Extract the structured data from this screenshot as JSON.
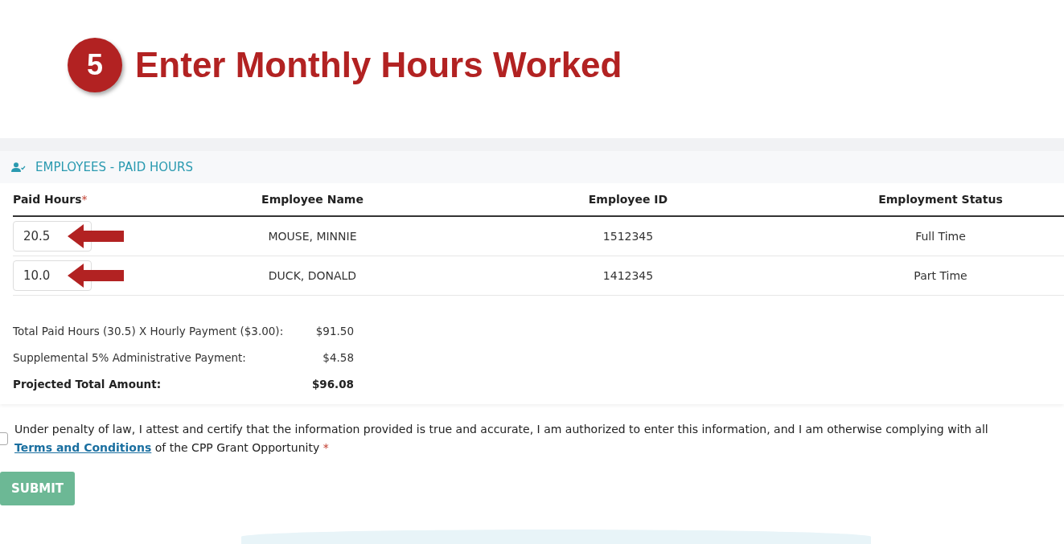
{
  "step": {
    "number": "5",
    "title": "Enter Monthly Hours Worked"
  },
  "section": {
    "title": "EMPLOYEES - PAID HOURS"
  },
  "table": {
    "columns": [
      {
        "label": "Paid Hours",
        "required_mark": "*"
      },
      {
        "label": "Employee Name"
      },
      {
        "label": "Employee ID"
      },
      {
        "label": "Employment Status"
      }
    ],
    "rows": [
      {
        "paid_hours": "20.5",
        "name": "MOUSE, MINNIE",
        "employee_id": "1512345",
        "status": "Full Time",
        "arrow": true
      },
      {
        "paid_hours": "10.0",
        "name": "DUCK, DONALD",
        "employee_id": "1412345",
        "status": "Part Time",
        "arrow": true
      }
    ]
  },
  "totals": [
    {
      "label": "Total Paid Hours (30.5) X Hourly Payment ($3.00):",
      "amount": "$91.50",
      "bold": false
    },
    {
      "label": "Supplemental 5% Administrative Payment:",
      "amount": "$4.58",
      "bold": false
    },
    {
      "label": "Projected Total Amount:",
      "amount": "$96.08",
      "bold": true
    }
  ],
  "attestation": {
    "checked": false,
    "text_before": "Under penalty of law, I attest and certify that the information provided is true and accurate, I am authorized to enter this information, and I am otherwise complying with all",
    "link": "Terms and Conditions",
    "text_after": "of the CPP Grant Opportunity",
    "required_mark": "*"
  },
  "submit": {
    "label": "SUBMIT",
    "disabled": true
  }
}
